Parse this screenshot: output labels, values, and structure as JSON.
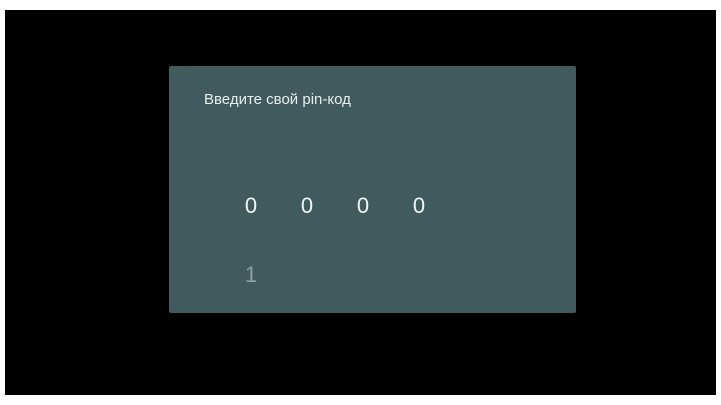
{
  "dialog": {
    "title": "Введите свой pin-код",
    "background_color": "#405a5d"
  },
  "pin": {
    "digits": [
      "0",
      "0",
      "0",
      "0"
    ],
    "next_value": "1"
  }
}
